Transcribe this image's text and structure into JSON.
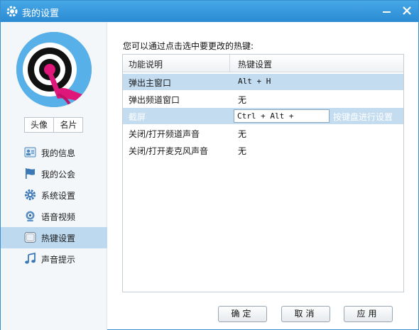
{
  "window": {
    "title": "我的设置"
  },
  "titlebar": {
    "minimize_glyph": "—",
    "close_glyph": "✕"
  },
  "avatar_tabs": {
    "avatar": "头像",
    "card": "名片"
  },
  "nav": {
    "items": [
      {
        "label": "我的信息",
        "icon": "profile-card-icon"
      },
      {
        "label": "我的公会",
        "icon": "flag-icon"
      },
      {
        "label": "系统设置",
        "icon": "gear-icon"
      },
      {
        "label": "语音视频",
        "icon": "webcam-icon"
      },
      {
        "label": "热键设置",
        "icon": "keyboard-icon",
        "active": true
      },
      {
        "label": "声音提示",
        "icon": "music-note-icon"
      }
    ]
  },
  "main": {
    "prompt": "您可以通过点击选中要更改的热键:",
    "table": {
      "headers": [
        "功能说明",
        "热键设置"
      ],
      "rows": [
        {
          "func": "弹出主窗口",
          "key": "Alt + H"
        },
        {
          "func": "弹出频道窗口",
          "key": "无"
        },
        {
          "func": "截屏",
          "key": "Ctrl + Alt + ",
          "hint": "按键盘进行设置"
        },
        {
          "func": "关闭/打开频道声音",
          "key": "无"
        },
        {
          "func": "关闭/打开麦克风声音",
          "key": "无"
        }
      ]
    }
  },
  "buttons": {
    "ok": "确定",
    "cancel": "取消",
    "apply": "应用"
  },
  "colors": {
    "titlebar": "#2b8bd3",
    "selection": "#c3dcf0",
    "active_nav": "#bcd9ef"
  }
}
